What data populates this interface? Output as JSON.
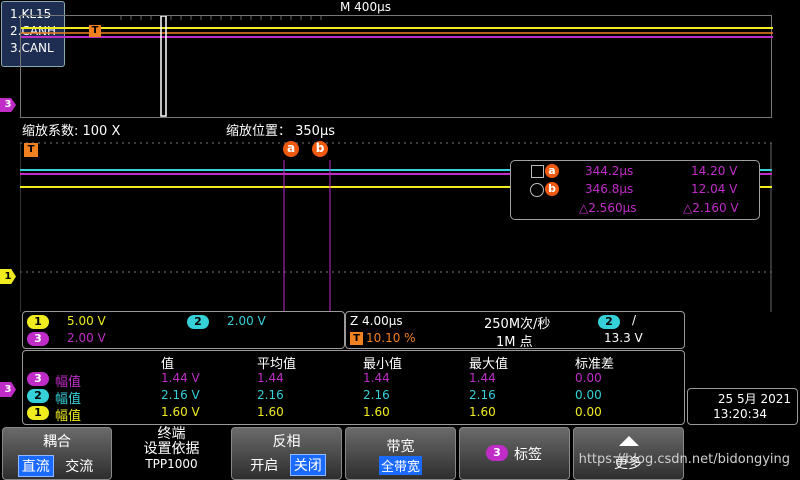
{
  "legend": {
    "items": [
      "1.KL15",
      "2.CANH",
      "3.CANL"
    ]
  },
  "overview": {
    "title": "M 400µs",
    "trigger_marker": "T"
  },
  "zoom": {
    "factor_label": "缩放系数: 100 X",
    "position_label": "缩放位置：  350µs"
  },
  "channel_markers": {
    "ch1": "1",
    "ch3": "3",
    "trigger": "T"
  },
  "cursors": {
    "a": {
      "marker": "a",
      "time": "344.2µs",
      "value": "14.20 V"
    },
    "b": {
      "marker": "b",
      "time": "346.8µs",
      "value": "12.04 V"
    },
    "delta_time": "△2.560µs",
    "delta_value": "△2.160 V"
  },
  "scales": {
    "ch1": {
      "chip": "1",
      "value": "5.00 V"
    },
    "ch2": {
      "chip": "2",
      "value": "2.00 V"
    },
    "ch3": {
      "chip": "3",
      "value": "2.00 V"
    }
  },
  "timebase": {
    "zoom": "Z 4.00µs",
    "sample_rate": "250M次/秒",
    "trigger_chip": "T",
    "trigger_percent": "10.10 %",
    "points": "1M 点",
    "trigger_source_chip": "2",
    "trigger_slope": "/",
    "trigger_level": "13.3 V"
  },
  "measurements": {
    "headers": [
      "值",
      "平均值",
      "最小值",
      "最大值",
      "标准差"
    ],
    "rows": [
      {
        "chip": "3",
        "name": "幅值",
        "values": [
          "1.44 V",
          "1.44",
          "1.44",
          "1.44",
          "0.00"
        ],
        "color": "#c02cc8"
      },
      {
        "chip": "2",
        "name": "幅值",
        "values": [
          "2.16 V",
          "2.16",
          "2.16",
          "2.16",
          "0.00"
        ],
        "color": "#35d0d8"
      },
      {
        "chip": "1",
        "name": "幅值",
        "values": [
          "1.60 V",
          "1.60",
          "1.60",
          "1.60",
          "0.00"
        ],
        "color": "#f0ec20"
      }
    ]
  },
  "datetime": {
    "date": "25 5月 2021",
    "time": "13:20:34"
  },
  "bottom": {
    "coupling": {
      "title": "耦合",
      "opt_dc": "直流",
      "opt_ac": "交流"
    },
    "termination": {
      "line1": "终端",
      "line2": "设置依据",
      "line3": "TPP1000"
    },
    "invert": {
      "title": "反相",
      "opt_on": "开启",
      "opt_off": "关闭"
    },
    "bandwidth": {
      "title": "带宽",
      "value": "全带宽"
    },
    "label": {
      "chip": "3",
      "title": "标签"
    },
    "more": {
      "title": "更多"
    }
  },
  "watermark": "https://blog.csdn.net/bidongying",
  "colors": {
    "ch1": "#f0ec20",
    "ch2": "#35d0d8",
    "ch3": "#c02cc8",
    "cursor": "#f05a10",
    "button_selected": "#1a6aff"
  }
}
